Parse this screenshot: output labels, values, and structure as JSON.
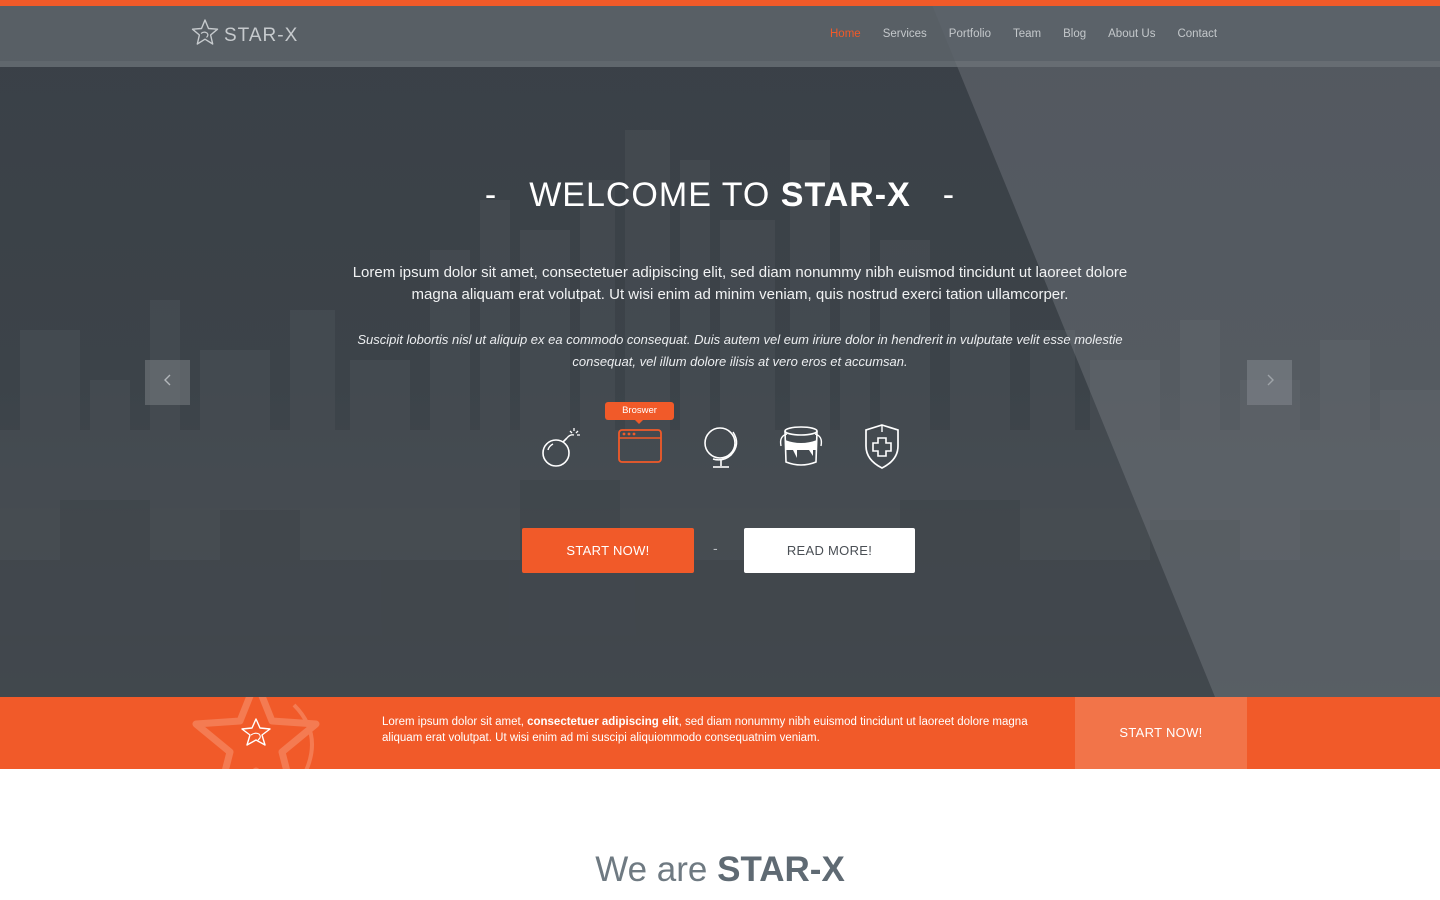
{
  "brand": {
    "name": "STAR-X",
    "accent": "#f15a29"
  },
  "nav": {
    "items": [
      {
        "label": "Home",
        "active": true
      },
      {
        "label": "Services",
        "active": false
      },
      {
        "label": "Portfolio",
        "active": false
      },
      {
        "label": "Team",
        "active": false
      },
      {
        "label": "Blog",
        "active": false
      },
      {
        "label": "About Us",
        "active": false
      },
      {
        "label": "Contact",
        "active": false
      }
    ]
  },
  "hero": {
    "title_prefix": "WELCOME TO",
    "title_brand": "STAR-X",
    "title_dash": "-",
    "lead": "Lorem ipsum dolor sit amet, consectetuer adipiscing elit, sed diam nonummy nibh euismod tincidunt ut laoreet dolore magna aliquam erat volutpat. Ut wisi enim ad minim veniam, quis nostrud exerci tation ullamcorper.",
    "italic": "Suscipit lobortis nisl ut aliquip ex ea commodo consequat. Duis autem vel eum iriure dolor in hendrerit in vulputate velit esse molestie consequat, vel illum dolore ilisis at vero eros et accumsan.",
    "icons": [
      "bomb-icon",
      "browser-icon",
      "globe-icon",
      "paint-bucket-icon",
      "shield-icon"
    ],
    "tooltip": "Broswer",
    "start_label": "START NOW!",
    "separator": "-",
    "read_label": "READ MORE!"
  },
  "band": {
    "text_before": "Lorem ipsum dolor sit amet, ",
    "text_bold": "consectetuer adipiscing elit",
    "text_after": ", sed diam nonummy nibh euismod tincidunt ut laoreet dolore magna aliquam erat volutpat. Ut wisi enim ad mi suscipi aliquiommodo consequatnim veniam.",
    "button_label": "START NOW!"
  },
  "about": {
    "heading_prefix": "We are",
    "heading_brand": "STAR-X"
  }
}
